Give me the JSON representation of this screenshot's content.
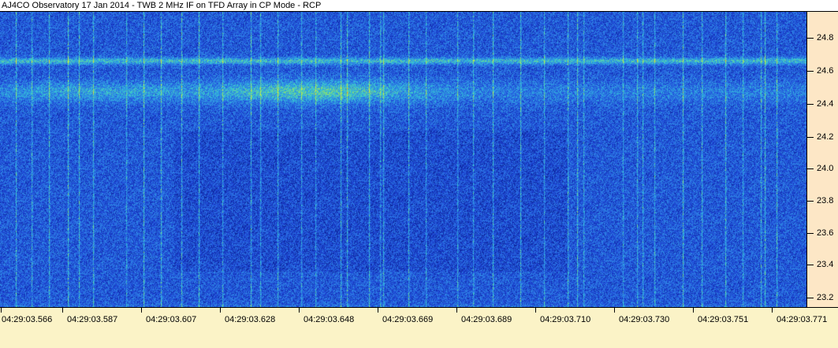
{
  "window": {
    "title": "AJ4CO Observatory 17 Jan 2014 - TWB 2 MHz IF on TFD Array in CP Mode - RCP"
  },
  "spectrogram": {
    "color_scale": [
      "#0a1f8f",
      "#1e46d6",
      "#2e7ee6",
      "#32c3d8",
      "#8fe06a",
      "#e8f030",
      "#ff6a1a"
    ]
  },
  "freq_axis": {
    "labels": [
      "24.8",
      "24.6",
      "24.4",
      "24.2",
      "24.0",
      "23.8",
      "23.6",
      "23.4",
      "23.2"
    ],
    "background": "#fde7c6"
  },
  "time_axis": {
    "labels": [
      "04:29:03.566",
      "04:29:03.587",
      "04:29:03.607",
      "04:29:03.628",
      "04:29:03.648",
      "04:29:03.669",
      "04:29:03.689",
      "04:29:03.710",
      "04:29:03.730",
      "04:29:03.751",
      "04:29:03.771"
    ],
    "background": "#fbf3c7"
  }
}
